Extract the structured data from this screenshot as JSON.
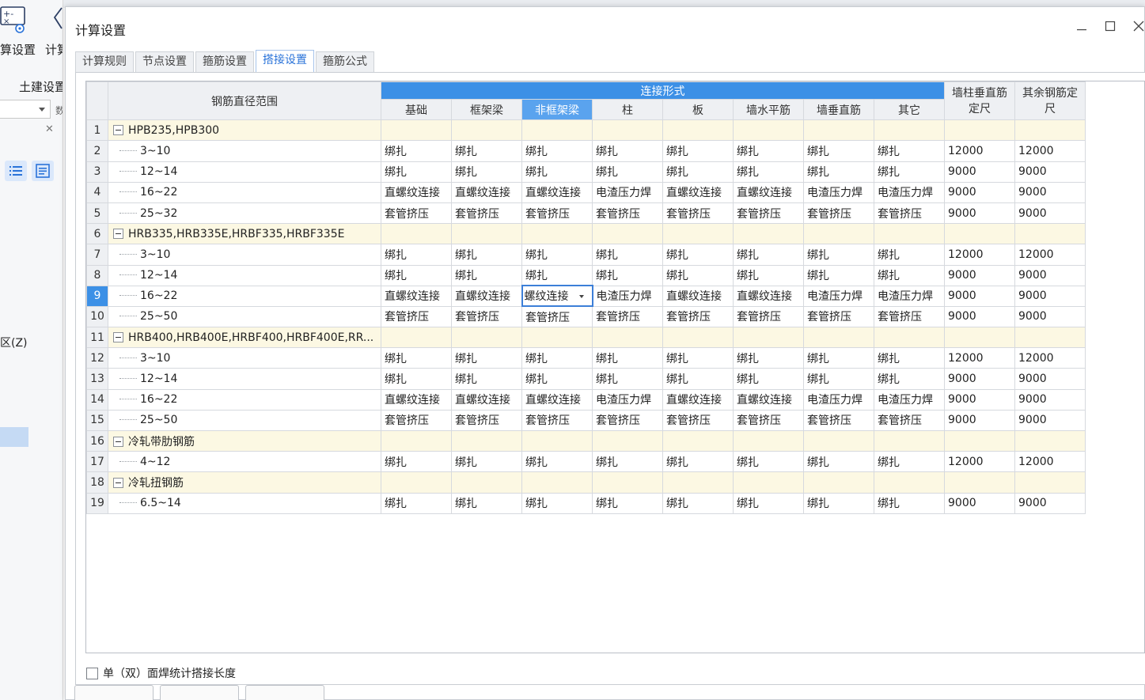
{
  "background_app": {
    "label_calc_settings": "算设置",
    "label_calc_2": "计算",
    "label_civil": "土建设置",
    "select_tail": "数",
    "panel_close": "✕",
    "label_zone": "区(Z)"
  },
  "dialog": {
    "title": "计算设置",
    "minimize": "—",
    "maximize": "☐",
    "close": "✕",
    "tabs": [
      "计算规则",
      "节点设置",
      "箍筋设置",
      "搭接设置",
      "箍筋公式"
    ],
    "active_tab": 3,
    "checkbox_label": "单（双）面焊统计搭接长度"
  },
  "table": {
    "header_range": "钢筋直径范围",
    "header_group": "连接形式",
    "header_wall_col": "墙柱垂直筋定尺",
    "header_other": "其余钢筋定尺",
    "sub_headers": [
      "基础",
      "框架梁",
      "非框架梁",
      "柱",
      "板",
      "墙水平筋",
      "墙垂直筋",
      "其它"
    ],
    "selected_header_index": 2,
    "selected_row": 9,
    "editing_cell_text": "螺纹连接",
    "rows": [
      {
        "n": "1",
        "group": true,
        "name": "HPB235,HPB300"
      },
      {
        "n": "2",
        "name": "3~10",
        "c": [
          "绑扎",
          "绑扎",
          "绑扎",
          "绑扎",
          "绑扎",
          "绑扎",
          "绑扎",
          "绑扎",
          "12000",
          "12000"
        ]
      },
      {
        "n": "3",
        "name": "12~14",
        "c": [
          "绑扎",
          "绑扎",
          "绑扎",
          "绑扎",
          "绑扎",
          "绑扎",
          "绑扎",
          "绑扎",
          "9000",
          "9000"
        ]
      },
      {
        "n": "4",
        "name": "16~22",
        "c": [
          "直螺纹连接",
          "直螺纹连接",
          "直螺纹连接",
          "电渣压力焊",
          "直螺纹连接",
          "直螺纹连接",
          "电渣压力焊",
          "电渣压力焊",
          "9000",
          "9000"
        ]
      },
      {
        "n": "5",
        "name": "25~32",
        "c": [
          "套管挤压",
          "套管挤压",
          "套管挤压",
          "套管挤压",
          "套管挤压",
          "套管挤压",
          "套管挤压",
          "套管挤压",
          "9000",
          "9000"
        ]
      },
      {
        "n": "6",
        "group": true,
        "name": "HRB335,HRB335E,HRBF335,HRBF335E"
      },
      {
        "n": "7",
        "name": "3~10",
        "c": [
          "绑扎",
          "绑扎",
          "绑扎",
          "绑扎",
          "绑扎",
          "绑扎",
          "绑扎",
          "绑扎",
          "12000",
          "12000"
        ]
      },
      {
        "n": "8",
        "name": "12~14",
        "c": [
          "绑扎",
          "绑扎",
          "绑扎",
          "绑扎",
          "绑扎",
          "绑扎",
          "绑扎",
          "绑扎",
          "9000",
          "9000"
        ]
      },
      {
        "n": "9",
        "name": "16~22",
        "c": [
          "直螺纹连接",
          "直螺纹连接",
          "螺纹连接",
          "电渣压力焊",
          "直螺纹连接",
          "直螺纹连接",
          "电渣压力焊",
          "电渣压力焊",
          "9000",
          "9000"
        ]
      },
      {
        "n": "10",
        "name": "25~50",
        "c": [
          "套管挤压",
          "套管挤压",
          "套管挤压",
          "套管挤压",
          "套管挤压",
          "套管挤压",
          "套管挤压",
          "套管挤压",
          "9000",
          "9000"
        ]
      },
      {
        "n": "11",
        "group": true,
        "name": "HRB400,HRB400E,HRBF400,HRBF400E,RR..."
      },
      {
        "n": "12",
        "name": "3~10",
        "c": [
          "绑扎",
          "绑扎",
          "绑扎",
          "绑扎",
          "绑扎",
          "绑扎",
          "绑扎",
          "绑扎",
          "12000",
          "12000"
        ]
      },
      {
        "n": "13",
        "name": "12~14",
        "c": [
          "绑扎",
          "绑扎",
          "绑扎",
          "绑扎",
          "绑扎",
          "绑扎",
          "绑扎",
          "绑扎",
          "9000",
          "9000"
        ]
      },
      {
        "n": "14",
        "name": "16~22",
        "c": [
          "直螺纹连接",
          "直螺纹连接",
          "直螺纹连接",
          "电渣压力焊",
          "直螺纹连接",
          "直螺纹连接",
          "电渣压力焊",
          "电渣压力焊",
          "9000",
          "9000"
        ]
      },
      {
        "n": "15",
        "name": "25~50",
        "c": [
          "套管挤压",
          "套管挤压",
          "套管挤压",
          "套管挤压",
          "套管挤压",
          "套管挤压",
          "套管挤压",
          "套管挤压",
          "9000",
          "9000"
        ]
      },
      {
        "n": "16",
        "group": true,
        "name": "冷轧带肋钢筋"
      },
      {
        "n": "17",
        "name": "4~12",
        "c": [
          "绑扎",
          "绑扎",
          "绑扎",
          "绑扎",
          "绑扎",
          "绑扎",
          "绑扎",
          "绑扎",
          "12000",
          "12000"
        ]
      },
      {
        "n": "18",
        "group": true,
        "name": "冷轧扭钢筋"
      },
      {
        "n": "19",
        "name": "6.5~14",
        "c": [
          "绑扎",
          "绑扎",
          "绑扎",
          "绑扎",
          "绑扎",
          "绑扎",
          "绑扎",
          "绑扎",
          "9000",
          "9000"
        ]
      }
    ]
  },
  "colors": {
    "accent": "#3c90e6",
    "group_row_bg": "#fcf8e3",
    "header_bg": "#eef0f3"
  }
}
